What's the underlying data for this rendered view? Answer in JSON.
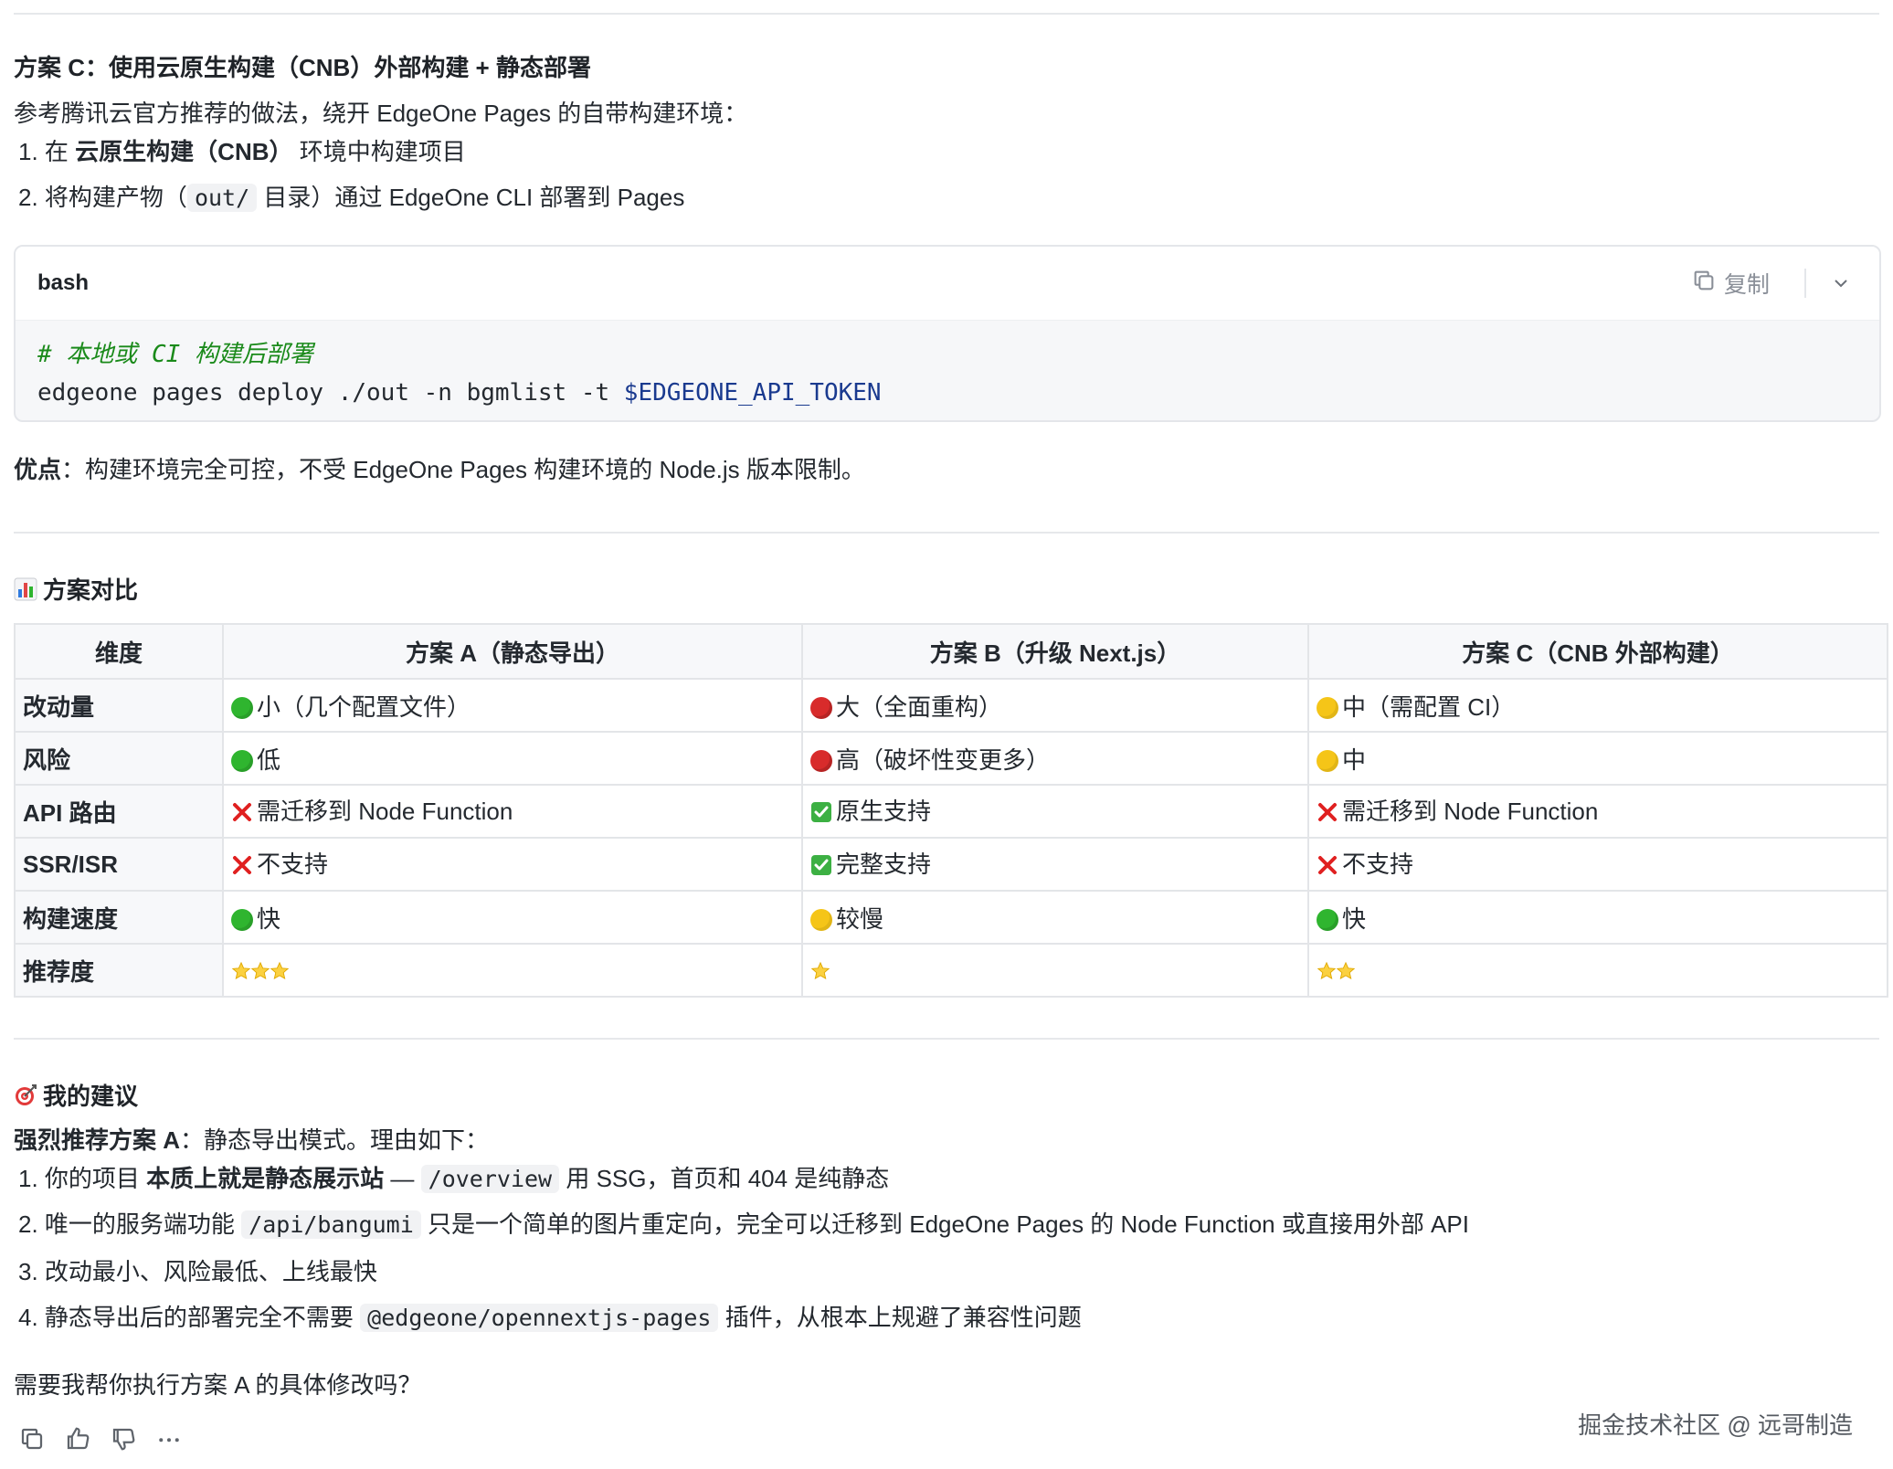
{
  "section_c": {
    "title": "方案 C：使用云原生构建（CNB）外部构建 + 静态部署",
    "intro": "参考腾讯云官方推荐的做法，绕开 EdgeOne Pages 的自带构建环境：",
    "step1_prefix": "在",
    "step1_bold": "云原生构建（CNB）",
    "step1_suffix": "环境中构建项目",
    "step2_prefix": "将构建产物（",
    "step2_code": "out/",
    "step2_suffix": "目录）通过 EdgeOne CLI 部署到 Pages",
    "advantage_label": "优点",
    "advantage_text": "：构建环境完全可控，不受 EdgeOne Pages 构建环境的 Node.js 版本限制。"
  },
  "codeblock": {
    "language": "bash",
    "copy_label": "复制",
    "comment_line": "# 本地或 CI 构建后部署",
    "cmd_prefix": "edgeone pages deploy ./out -n bgmlist -t ",
    "cmd_var": "$EDGEONE_API_TOKEN"
  },
  "comparison": {
    "heading": "方案对比",
    "heading_icon": "bar-chart-icon",
    "headers": [
      "维度",
      "方案 A（静态导出）",
      "方案 B（升级 Next.js）",
      "方案 C（CNB 外部构建）"
    ],
    "rows": [
      {
        "dim": "改动量",
        "a": "小（几个配置文件）",
        "a_icon": "green",
        "b": "大（全面重构）",
        "b_icon": "red",
        "c": "中（需配置 CI）",
        "c_icon": "yellow"
      },
      {
        "dim": "风险",
        "a": "低",
        "a_icon": "green",
        "b": "高（破坏性变更多）",
        "b_icon": "red",
        "c": "中",
        "c_icon": "yellow"
      },
      {
        "dim": "API 路由",
        "a": "需迁移到 Node Function",
        "a_icon": "cross",
        "b": "原生支持",
        "b_icon": "check",
        "c": "需迁移到 Node Function",
        "c_icon": "cross"
      },
      {
        "dim": "SSR/ISR",
        "a": "不支持",
        "a_icon": "cross",
        "b": "完整支持",
        "b_icon": "check",
        "c": "不支持",
        "c_icon": "cross"
      },
      {
        "dim": "构建速度",
        "a": "快",
        "a_icon": "green",
        "b": "较慢",
        "b_icon": "yellow",
        "c": "快",
        "c_icon": "green"
      },
      {
        "dim": "推荐度",
        "a_stars": 3,
        "b_stars": 1,
        "c_stars": 2
      }
    ]
  },
  "advice": {
    "heading": "我的建议",
    "heading_icon": "target-icon",
    "lead_bold": "强烈推荐方案 A",
    "lead_text": "：静态导出模式。理由如下：",
    "item1_prefix": "你的项目",
    "item1_bold": "本质上就是静态展示站",
    "item1_mid": " — ",
    "item1_code": "/overview",
    "item1_suffix": "用 SSG，首页和 404 是纯静态",
    "item2_prefix": "唯一的服务端功能",
    "item2_code": "/api/bangumi",
    "item2_suffix": "只是一个简单的图片重定向，完全可以迁移到 EdgeOne Pages 的 Node Function 或直接用外部 API",
    "item3": "改动最小、风险最低、上线最快",
    "item4_prefix": "静态导出后的部署完全不需要",
    "item4_code": "@edgeone/opennextjs-pages",
    "item4_suffix": "插件，从根本上规避了兼容性问题",
    "question": "需要我帮你执行方案 A 的具体修改吗？"
  },
  "watermark": "掘金技术社区 @ 远哥制造"
}
